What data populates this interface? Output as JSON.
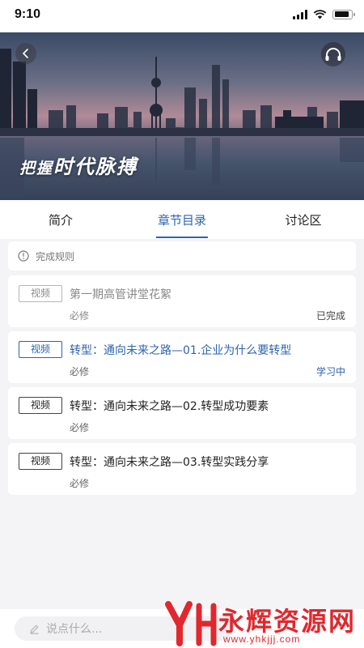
{
  "status_bar": {
    "time": "9:10"
  },
  "hero": {
    "caption_small": "把握",
    "caption_large": "时代脉搏"
  },
  "tabs": [
    {
      "label": "简介",
      "active": false
    },
    {
      "label": "章节目录",
      "active": true
    },
    {
      "label": "讨论区",
      "active": false
    }
  ],
  "rules": {
    "label": "完成规则"
  },
  "lessons": [
    {
      "badge": "视频",
      "title": "第一期高管讲堂花絮",
      "requirement": "必修",
      "status": "已完成"
    },
    {
      "badge": "视频",
      "title": "转型：通向未来之路—01.企业为什么要转型",
      "requirement": "必修",
      "status": "学习中"
    },
    {
      "badge": "视频",
      "title": "转型：通向未来之路—02.转型成功要素",
      "requirement": "必修",
      "status": ""
    },
    {
      "badge": "视频",
      "title": "转型：通向未来之路—03.转型实践分享",
      "requirement": "必修",
      "status": ""
    }
  ],
  "comment": {
    "placeholder": "说点什么..."
  },
  "watermark": {
    "title": "永辉资源网",
    "url": "www.yhkjjj.com"
  },
  "colors": {
    "accent": "#2d64b0",
    "watermark": "#e0282e"
  }
}
